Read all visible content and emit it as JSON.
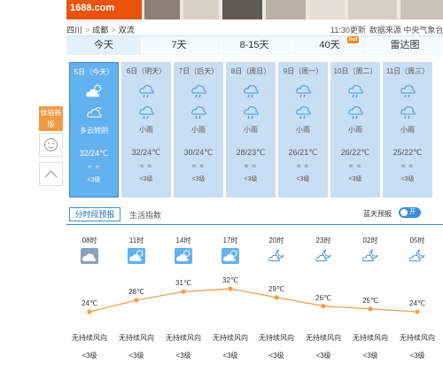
{
  "ad": {
    "logo_text": "1688.com"
  },
  "breadcrumb": [
    "四川",
    "成都",
    "双流"
  ],
  "update": {
    "time": "11:30更新",
    "source": "数据来源 中央气象台"
  },
  "tabs": [
    "今天",
    "7天",
    "8-15天",
    "40天",
    "雷达图"
  ],
  "tab_badge": "hot",
  "days": [
    {
      "date": "5日（今天）",
      "weather": "多云转阴",
      "temp": "32/24℃",
      "wind_icon": "≈ ≈",
      "level": "<3级",
      "icon1": "partly-cloudy-icon",
      "icon2": "cloudy-icon",
      "selected": true
    },
    {
      "date": "6日（明天）",
      "weather": "小雨",
      "temp": "32/24℃",
      "wind_icon": "≈ ≈",
      "level": "<3级",
      "icon1": "light-rain-icon",
      "icon2": "light-rain-icon",
      "selected": false
    },
    {
      "date": "7日（后天）",
      "weather": "小雨",
      "temp": "30/24℃",
      "wind_icon": "≈ ≈",
      "level": "<3级",
      "icon1": "light-rain-icon",
      "icon2": "light-rain-icon",
      "selected": false
    },
    {
      "date": "8日（周日）",
      "weather": "小雨",
      "temp": "28/23℃",
      "wind_icon": "≈ ≈",
      "level": "<3级",
      "icon1": "light-rain-icon",
      "icon2": "light-rain-icon",
      "selected": false
    },
    {
      "date": "9日（周一）",
      "weather": "小雨",
      "temp": "26/21℃",
      "wind_icon": "≈ ≈",
      "level": "<3级",
      "icon1": "light-rain-icon",
      "icon2": "light-rain-icon",
      "selected": false
    },
    {
      "date": "10日（周二）",
      "weather": "小雨",
      "temp": "26/22℃",
      "wind_icon": "≈ ≈",
      "level": "<3级",
      "icon1": "light-rain-icon",
      "icon2": "light-rain-icon",
      "selected": false
    },
    {
      "date": "11日（周三）",
      "weather": "小雨",
      "temp": "25/22℃",
      "wind_icon": "≈ ≈",
      "level": "<3级",
      "icon1": "light-rain-icon",
      "icon2": "light-rain-icon",
      "selected": false
    }
  ],
  "side_tools": {
    "badge": "体验新版"
  },
  "subtabs": {
    "hourly": "分时段预报",
    "living": "生活指数"
  },
  "blue_sky": {
    "label": "蓝天预报",
    "toggle": "开"
  },
  "hourly": [
    {
      "time": "08时",
      "temp": "24℃",
      "wind": "无持续风向",
      "level": "<3级",
      "icon": "overcast-icon"
    },
    {
      "time": "11时",
      "temp": "28℃",
      "wind": "无持续风向",
      "level": "<3级",
      "icon": "partly-cloudy-icon"
    },
    {
      "time": "14时",
      "temp": "31℃",
      "wind": "无持续风向",
      "level": "<3级",
      "icon": "partly-cloudy-icon"
    },
    {
      "time": "17时",
      "temp": "32℃",
      "wind": "无持续风向",
      "level": "<3级",
      "icon": "partly-cloudy-icon"
    },
    {
      "time": "20时",
      "temp": "29℃",
      "wind": "无持续风向",
      "level": "<3级",
      "icon": "partly-cloudy-night-icon"
    },
    {
      "time": "23时",
      "temp": "26℃",
      "wind": "无持续风向",
      "level": "<3级",
      "icon": "partly-cloudy-night-icon"
    },
    {
      "time": "02时",
      "temp": "25℃",
      "wind": "无持续风向",
      "level": "<3级",
      "icon": "partly-cloudy-night-icon"
    },
    {
      "time": "05时",
      "temp": "24℃",
      "wind": "无持续风向",
      "level": "<3级",
      "icon": "partly-cloudy-night-icon"
    }
  ],
  "chart_data": {
    "type": "line",
    "categories": [
      "08时",
      "11时",
      "14时",
      "17时",
      "20时",
      "23时",
      "02时",
      "05时"
    ],
    "values": [
      24,
      28,
      31,
      32,
      29,
      26,
      25,
      24
    ],
    "unit": "℃"
  },
  "colors": {
    "accent": "#3d8fd4",
    "selected_day": "#63b1ee",
    "day_bg": "#c8dff3",
    "line": "#f0a04b",
    "badge": "#f09b44"
  }
}
